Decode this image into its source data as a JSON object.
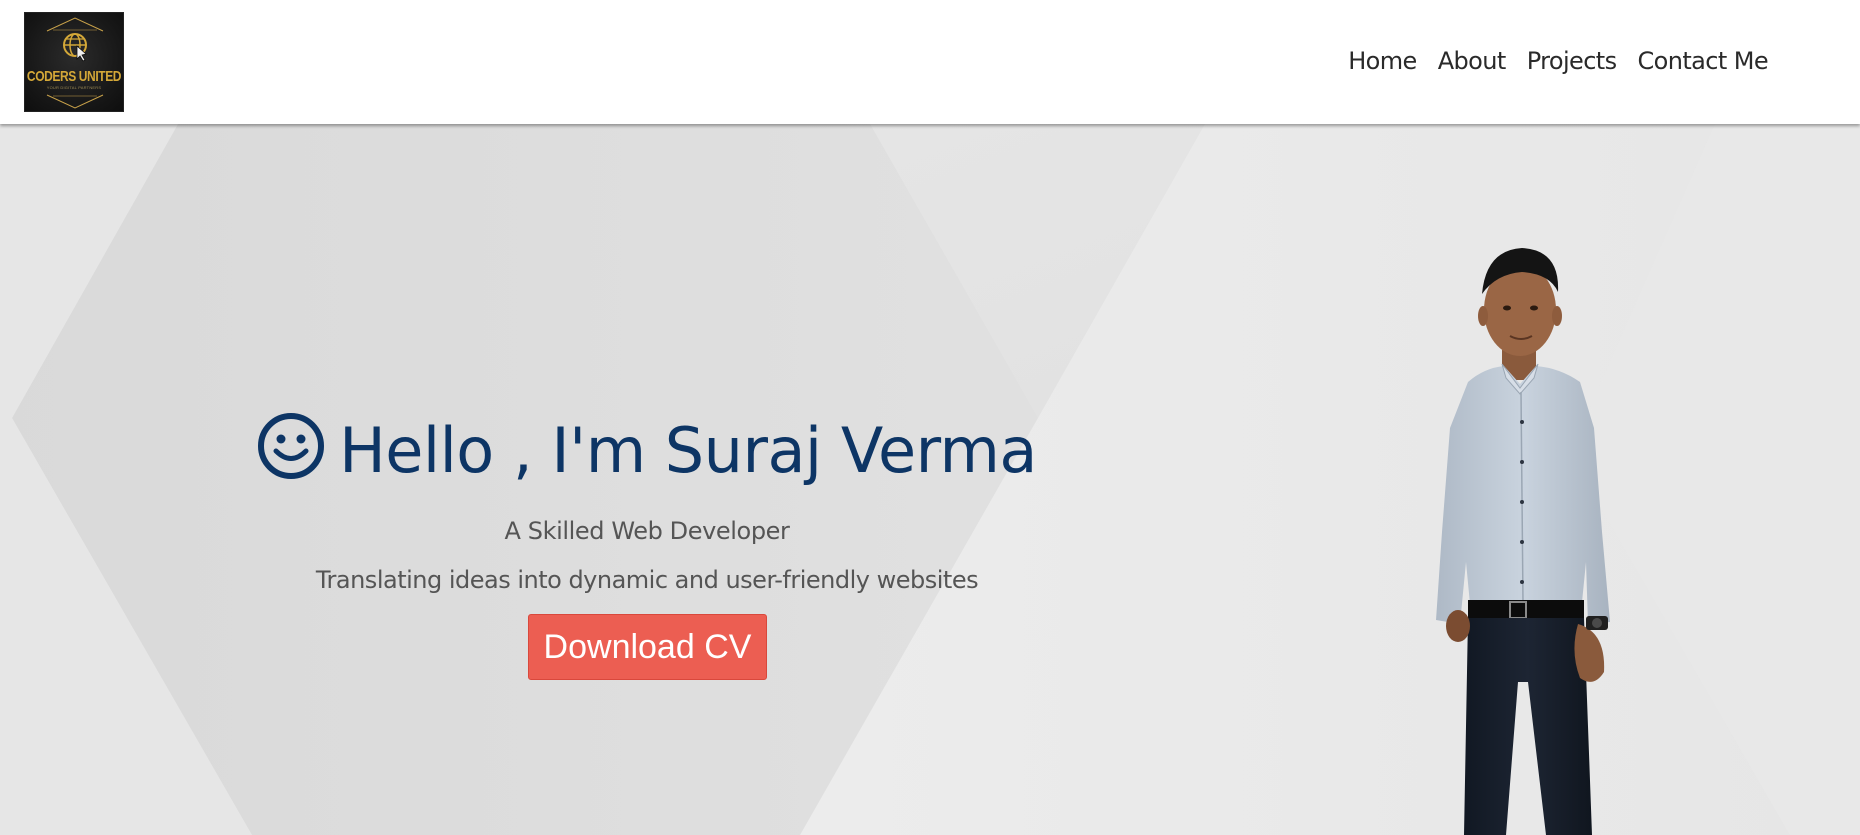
{
  "header": {
    "logo": {
      "title": "CODERS UNITED",
      "tagline": "YOUR DIGITAL PARTNERS",
      "icon": "globe-cursor-icon",
      "gold": "#d4a838"
    },
    "nav": [
      {
        "label": "Home"
      },
      {
        "label": "About"
      },
      {
        "label": "Projects"
      },
      {
        "label": "Contact Me"
      }
    ]
  },
  "hero": {
    "greeting_icon": "smiley-icon",
    "greeting": "Hello , I'm Suraj Verma",
    "subtitle": "A Skilled Web Developer",
    "tagline": "Translating ideas into dynamic and user-friendly websites",
    "cta_label": "Download CV",
    "colors": {
      "heading": "#0d3565",
      "cta": "#ec5e52",
      "text": "#555555"
    }
  }
}
